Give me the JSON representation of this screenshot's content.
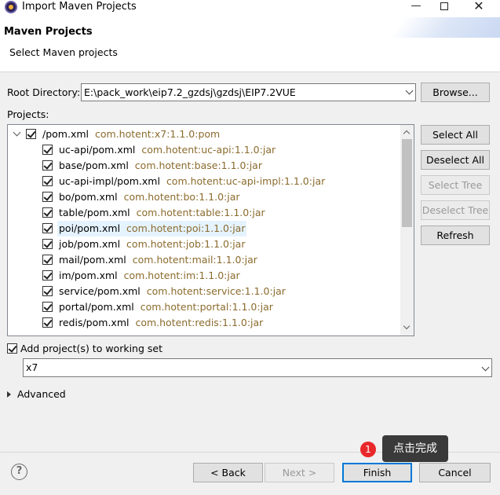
{
  "window": {
    "title": "Import Maven Projects",
    "minimize_glyph": "—",
    "close_glyph": "✕"
  },
  "header": {
    "title": "Maven Projects",
    "subtitle": "Select Maven projects"
  },
  "root_directory": {
    "label": "Root Directory:",
    "value": "E:\\pack_work\\eip7.2_gzdsj\\gzdsj\\EIP7.2VUE",
    "browse_label": "Browse..."
  },
  "projects": {
    "label": "Projects:",
    "root": {
      "name": "/pom.xml",
      "coords": "com.hotent:x7:1.1.0:pom",
      "checked": true,
      "expanded": true
    },
    "modules": [
      {
        "name": "uc-api/pom.xml",
        "coords": "com.hotent:uc-api:1.1.0:jar",
        "checked": true
      },
      {
        "name": "base/pom.xml",
        "coords": "com.hotent:base:1.1.0:jar",
        "checked": true
      },
      {
        "name": "uc-api-impl/pom.xml",
        "coords": "com.hotent:uc-api-impl:1.1.0:jar",
        "checked": true
      },
      {
        "name": "bo/pom.xml",
        "coords": "com.hotent:bo:1.1.0:jar",
        "checked": true
      },
      {
        "name": "table/pom.xml",
        "coords": "com.hotent:table:1.1.0:jar",
        "checked": true
      },
      {
        "name": "poi/pom.xml",
        "coords": "com.hotent:poi:1.1.0:jar",
        "checked": true,
        "selected": true
      },
      {
        "name": "job/pom.xml",
        "coords": "com.hotent:job:1.1.0:jar",
        "checked": true
      },
      {
        "name": "mail/pom.xml",
        "coords": "com.hotent:mail:1.1.0:jar",
        "checked": true
      },
      {
        "name": "im/pom.xml",
        "coords": "com.hotent:im:1.1.0:jar",
        "checked": true
      },
      {
        "name": "service/pom.xml",
        "coords": "com.hotent:service:1.1.0:jar",
        "checked": true
      },
      {
        "name": "portal/pom.xml",
        "coords": "com.hotent:portal:1.1.0:jar",
        "checked": true
      },
      {
        "name": "redis/pom.xml",
        "coords": "com.hotent:redis:1.1.0:jar",
        "checked": true
      }
    ]
  },
  "side_buttons": {
    "select_all": "Select All",
    "deselect_all": "Deselect All",
    "select_tree": "Select Tree",
    "deselect_tree": "Deselect Tree",
    "refresh": "Refresh"
  },
  "working_set": {
    "checkbox_label": "Add project(s) to working set",
    "checked": true,
    "value": "x7"
  },
  "advanced": {
    "label": "Advanced"
  },
  "footer": {
    "help_glyph": "?",
    "back": "< Back",
    "next": "Next >",
    "finish": "Finish",
    "cancel": "Cancel"
  },
  "annotation": {
    "badge": "1",
    "text": "点击完成"
  }
}
